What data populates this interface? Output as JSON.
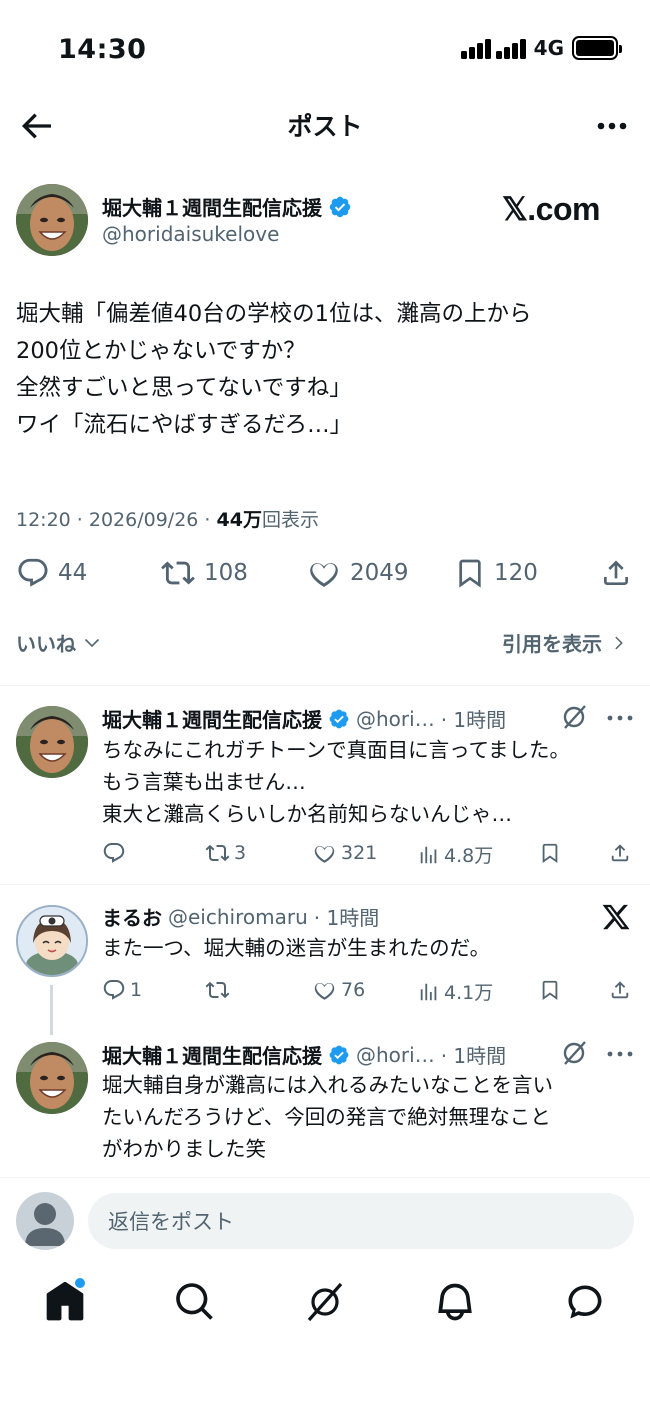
{
  "status_bar": {
    "time": "14:30",
    "network": "4G"
  },
  "nav": {
    "title": "ポスト"
  },
  "main_post": {
    "author_name": "堀大輔１週間生配信応援",
    "author_handle": "@horidaisukelove",
    "watermark": "𝕏.com",
    "text": "堀大輔「偏差値40台の学校の1位は、灘高の上から\n200位とかじゃないですか？\n全然すごいと思ってないですね」\nワイ「流石にやばすぎるだろ…」",
    "time": "12:20 · 2026/09/26 · ",
    "views_count": "44万",
    "views_label": "回表示",
    "replies": "44",
    "reposts": "108",
    "likes": "2049",
    "bookmarks": "120"
  },
  "tabs_row": {
    "likes_tab": "いいね",
    "quotes_link": "引用を表示"
  },
  "replies": [
    {
      "name": "堀大輔１週間生配信応援",
      "handle": "@hori…",
      "time": "· 1時間",
      "text": "ちなみにこれガチトーンで真面目に言ってました。\nもう言葉も出ません…\n東大と灘高くらいしか名前知らないんじゃ…",
      "replies": "",
      "reposts": "3",
      "likes": "321",
      "views": "4.8万"
    },
    {
      "name": "まるお",
      "handle": "@eichiromaru",
      "time": "· 1時間",
      "text": "また一つ、堀大輔の迷言が生まれたのだ。",
      "replies": "1",
      "reposts": "",
      "likes": "76",
      "views": "4.1万"
    },
    {
      "name": "堀大輔１週間生配信応援",
      "handle": "@hori…",
      "time": "· 1時間",
      "text": "堀大輔自身が灘高には入れるみたいなことを言い\nたいんだろうけど、今回の発言で絶対無理なこと\nがわかりました笑"
    }
  ],
  "composer": {
    "placeholder": "返信をポスト"
  },
  "colors": {
    "verified": "#1d9bf0",
    "text": "#0f1419",
    "secondary": "#536471",
    "notification_dot": "#1d9bf0"
  }
}
